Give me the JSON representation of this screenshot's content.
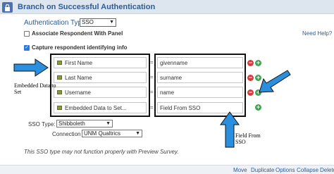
{
  "header": {
    "title": "Branch on Successful Authentication"
  },
  "auth": {
    "label": "Authentication Type:",
    "value": "SSO"
  },
  "help": {
    "label": "Need Help?"
  },
  "options": {
    "associate": "Associate Respondent With Panel",
    "capture": "Capture respondent identifying info"
  },
  "fields": [
    {
      "left": "First Name",
      "right": "givenname"
    },
    {
      "left": "Last Name",
      "right": "surname"
    },
    {
      "left": "Username",
      "right": "name"
    },
    {
      "left": "Embedded Data to Set...",
      "right": "Field From SSO"
    }
  ],
  "equals": "=",
  "sso": {
    "type_label": "SSO Type:",
    "type_value": "Shibboleth",
    "connection_label": "Connection",
    "connection_value": "UNM Qualtrics"
  },
  "note": "This SSO type may not function properly with Preview Survey.",
  "footer": {
    "move": "Move",
    "duplicate": "Duplicate",
    "options": "Options",
    "collapse": "Collapse",
    "delete": "Delete"
  },
  "annotations": {
    "embedded": "Embedded Data to Set",
    "field_from_sso": "Field From SSO"
  },
  "colors": {
    "accent": "#2d5c96",
    "arrow": "#2b8fe0",
    "remove": "#d93a3a",
    "add": "#3aa84a"
  },
  "icons": [
    "lock-icon",
    "field-tag-icon",
    "remove-icon",
    "add-icon",
    "checkmark-icon",
    "chevron-down-icon",
    "arrow-icon"
  ]
}
